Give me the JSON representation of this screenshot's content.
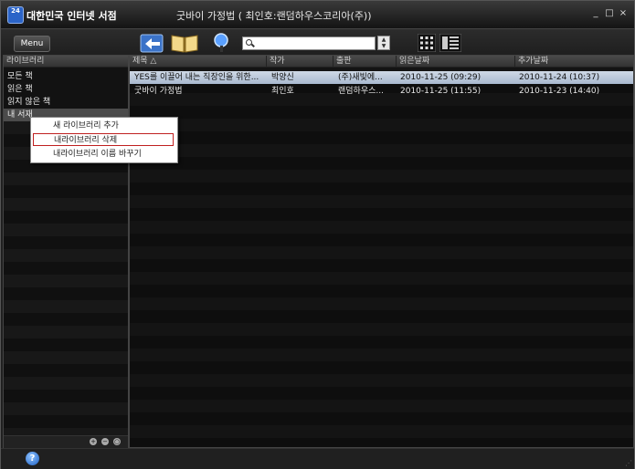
{
  "app": {
    "logo_text": "24",
    "title": "대한민국 인터넷 서점",
    "window_title": "굿바이 가정법 ( 최인호:랜덤하우스코리아(주))"
  },
  "window_controls": {
    "minimize": "_",
    "maximize": "□",
    "close": "×"
  },
  "toolbar": {
    "menu_label": "Menu",
    "search_value": "",
    "spin_up": "▲",
    "spin_down": "▼"
  },
  "sidebar": {
    "header": "라이브러리",
    "items": [
      {
        "label": "모든 책"
      },
      {
        "label": "읽은 책"
      },
      {
        "label": "읽지 않은 책"
      },
      {
        "label": "내 서재"
      }
    ],
    "footer_buttons": [
      "+",
      "−",
      "○"
    ]
  },
  "table": {
    "columns": [
      {
        "label": "제목 △"
      },
      {
        "label": "작가"
      },
      {
        "label": "출판"
      },
      {
        "label": "읽은날짜"
      },
      {
        "label": "추가날짜"
      }
    ],
    "rows": [
      {
        "title": "YES를 이끌어 내는 직장인을 위한...",
        "author": "박양신",
        "publisher": "(주)새빛에...",
        "read_date": "2010-11-25 (09:29)",
        "added_date": "2010-11-24 (10:37)"
      },
      {
        "title": "굿바이 가정법",
        "author": "최인호",
        "publisher": "랜덤하우스...",
        "read_date": "2010-11-25 (11:55)",
        "added_date": "2010-11-23 (14:40)"
      }
    ]
  },
  "context_menu": {
    "items": [
      {
        "label": "새 라이브러리 추가"
      },
      {
        "label": "내라이브러리 삭제"
      },
      {
        "label": "내라이브러리 이름 바꾸기"
      }
    ]
  },
  "status": {
    "help_label": "?",
    "grip": "⋰"
  }
}
